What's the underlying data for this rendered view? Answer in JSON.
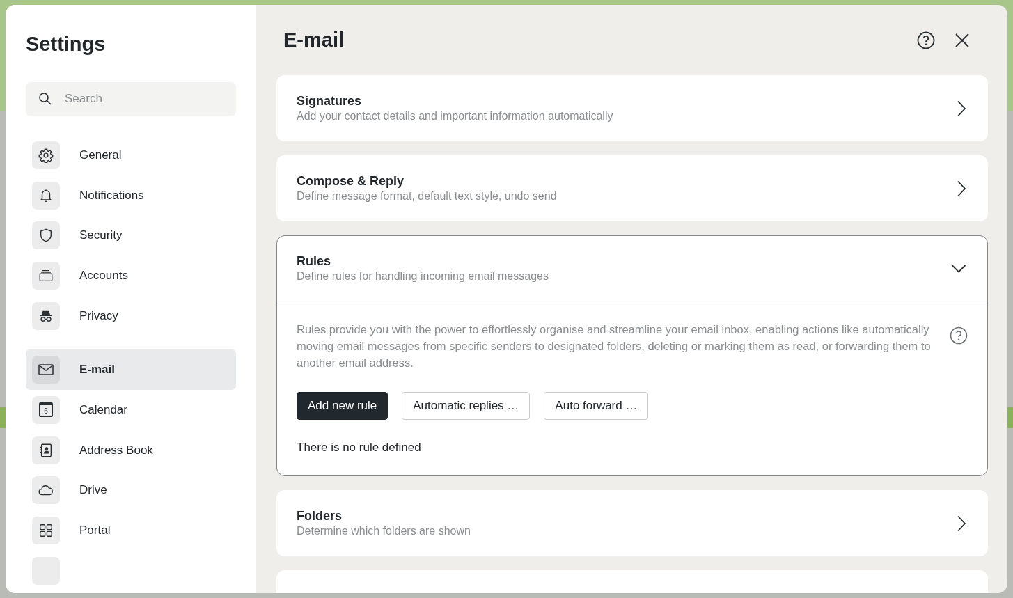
{
  "sidebar": {
    "title": "Settings",
    "search": {
      "placeholder": "Search"
    },
    "groups": [
      [
        {
          "label": "General",
          "kind": "gear",
          "selected": false
        },
        {
          "label": "Notifications",
          "kind": "bell",
          "selected": false
        },
        {
          "label": "Security",
          "kind": "shield",
          "selected": false
        },
        {
          "label": "Accounts",
          "kind": "stack",
          "selected": false
        },
        {
          "label": "Privacy",
          "kind": "incognito",
          "selected": false
        }
      ],
      [
        {
          "label": "E-mail",
          "kind": "mail",
          "selected": true
        },
        {
          "label": "Calendar",
          "kind": "calendar",
          "icon_text": "6",
          "selected": false
        },
        {
          "label": "Address Book",
          "kind": "contact",
          "selected": false
        },
        {
          "label": "Drive",
          "kind": "cloud",
          "selected": false
        },
        {
          "label": "Portal",
          "kind": "grid",
          "selected": false
        }
      ]
    ]
  },
  "main": {
    "title": "E-mail",
    "sections": [
      {
        "title": "Signatures",
        "subtitle": "Add your contact details and important information automatically",
        "expanded": false
      },
      {
        "title": "Compose & Reply",
        "subtitle": "Define message format, default text style, undo send",
        "expanded": false
      },
      {
        "title": "Rules",
        "subtitle": "Define rules for handling incoming email messages",
        "expanded": true,
        "description": "Rules provide you with the power to effortlessly organise and streamline your email inbox, enabling actions like automatically moving email messages from specific senders to designated folders, deleting or marking them as read, or forwarding them to another email address.",
        "buttons": [
          {
            "label": "Add new rule",
            "kind": "primary"
          },
          {
            "label": "Automatic replies …",
            "kind": "secondary"
          },
          {
            "label": "Auto forward …",
            "kind": "secondary"
          }
        ],
        "empty_text": "There is no rule defined"
      },
      {
        "title": "Folders",
        "subtitle": "Determine which folders are shown",
        "expanded": false
      }
    ]
  }
}
